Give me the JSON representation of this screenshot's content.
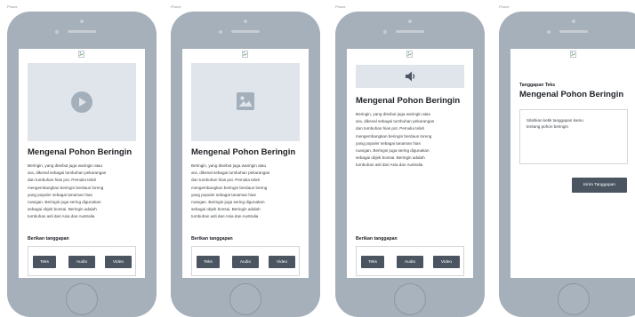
{
  "frames": [
    {
      "label": "Phone",
      "media_type": "video",
      "title": "Mengenal Pohon Beringin",
      "description_lines": [
        "Beringin, yang disebut juga waringin atau",
        "ara, dikenal sebagai tumbuhan pekarangan",
        "dan tumbuhan hias pot. Pemulia telah",
        "mengembangkan beringin berdaun loreng",
        "yang populer sebagai tanaman hias",
        "ruangan. Beringin juga sering digunakan",
        "sebagai objek bonsai. Beringin adalah",
        "tumbuhan asli dari Asia dan Australia"
      ],
      "response_label": "Berikan tanggapan",
      "buttons": [
        "Teks",
        "Audio",
        "Video"
      ]
    },
    {
      "label": "Phone",
      "media_type": "image",
      "title": "Mengenal Pohon Beringin",
      "description_lines": [
        "Beringin, yang disebut juga waringin atau",
        "ara, dikenal sebagai tumbuhan pekarangan",
        "dan tumbuhan hias pot. Pemulia telah",
        "mengembangkan beringin berdaun loreng",
        "yang populer sebagai tanaman hias",
        "ruangan. Beringin juga sering digunakan",
        "sebagai objek bonsai. Beringin adalah",
        "tumbuhan asli dari Asia dan Australia"
      ],
      "response_label": "Berikan tanggapan",
      "buttons": [
        "Teks",
        "Audio",
        "Video"
      ]
    },
    {
      "label": "Phone",
      "media_type": "audio",
      "title": "Mengenal Pohon Beringin",
      "description_lines": [
        "Beringin, yang disebut juga waringin atau",
        "ara, dikenal sebagai tumbuhan pekarangan",
        "dan tumbuhan hias pot. Pemulia telah",
        "mengembangkan beringin berdaun loreng",
        "yang populer sebagai tanaman hias",
        "ruangan. Beringin juga sering digunakan",
        "sebagai objek bonsai. Beringin adalah",
        "tumbuhan asli dari Asia dan Australia"
      ],
      "response_label": "Berikan tanggapan",
      "buttons": [
        "Teks",
        "Audio",
        "Video"
      ]
    },
    {
      "label": "Phone",
      "subheading": "Tanggapan Teks",
      "title": "Mengenal Pohon Beringin",
      "textarea_placeholder_lines": [
        "Silahkan ketik tanggapan kamu",
        "tentang pohon beringin"
      ],
      "submit_label": "Kirim Tanggapan"
    }
  ],
  "colors": {
    "phone_body": "#a6b0ba",
    "media_placeholder": "#e0e5ec",
    "icon_fill": "#a3afbb",
    "button_fill": "#4a5561",
    "button_text": "#ffffff",
    "text": "#1e2226"
  },
  "icons": {
    "broken_image": "broken-image-icon",
    "video": "play-icon",
    "image": "image-icon",
    "audio": "speaker-icon"
  }
}
